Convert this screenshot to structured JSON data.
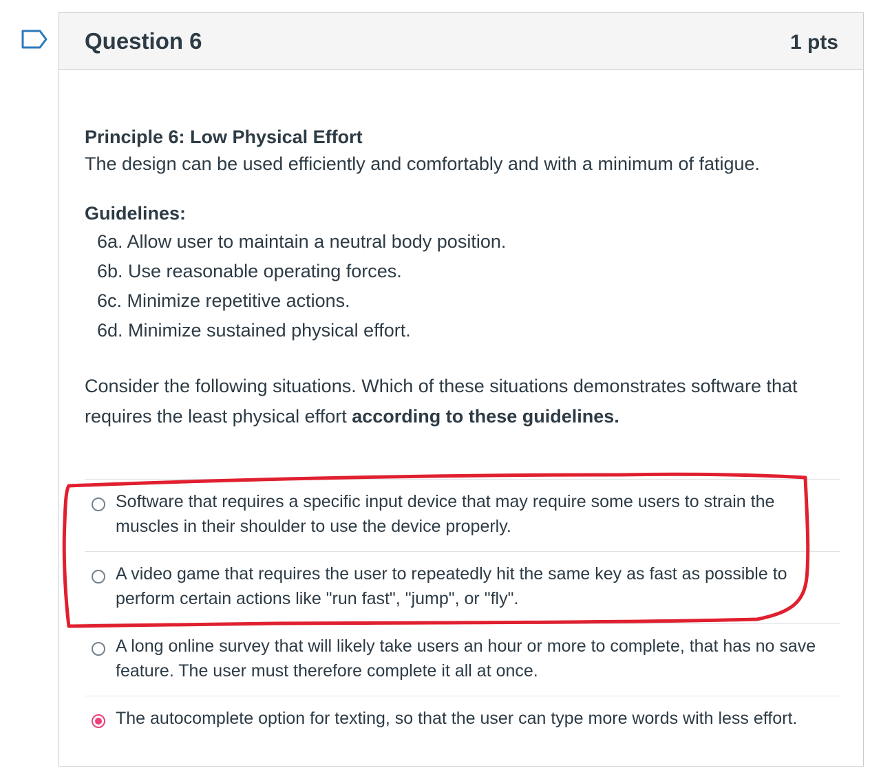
{
  "question": {
    "title": "Question 6",
    "points": "1 pts",
    "flag_icon": "flag-icon"
  },
  "principle": {
    "title": "Principle 6: Low Physical Effort",
    "description": "The design can be used efficiently and comfortably and with a minimum of fatigue."
  },
  "guidelines": {
    "title": "Guidelines:",
    "items": [
      "6a. Allow user to maintain a neutral body position.",
      "6b. Use reasonable operating forces.",
      "6c. Minimize repetitive actions.",
      "6d. Minimize sustained physical effort."
    ]
  },
  "prompt": {
    "text": "Consider the following situations. Which of these situations demonstrates software that requires the least physical effort ",
    "emphasis": "according to these guidelines."
  },
  "answers": [
    {
      "label": "Software that requires a specific input device that may require some users to strain the muscles in their shoulder to use the device properly.",
      "selected": false
    },
    {
      "label": "A video game that requires the user to repeatedly hit the same key as fast as possible to perform certain actions like \"run fast\", \"jump\", or \"fly\".",
      "selected": false
    },
    {
      "label": "A long online survey that will likely take users an hour or more to complete, that has no save feature. The user must therefore complete it all at once.",
      "selected": false
    },
    {
      "label": "The autocomplete option for texting, so that the user can type more words with less effort.",
      "selected": true
    }
  ],
  "colors": {
    "selected_radio": "#ec407a",
    "annotation": "#e0202f"
  }
}
